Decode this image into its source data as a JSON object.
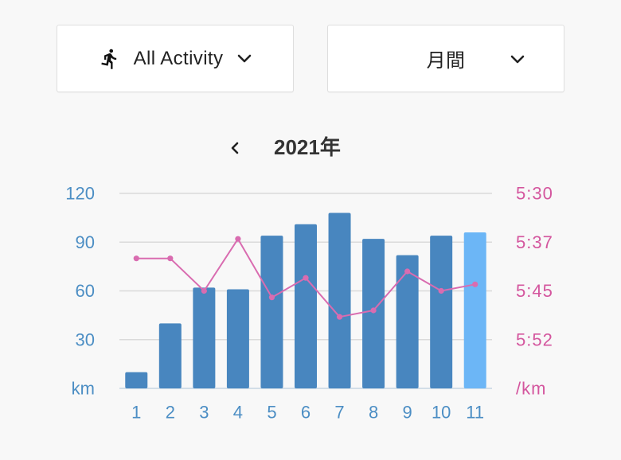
{
  "filters": {
    "activity": {
      "label": "All Activity",
      "icon": "running-person-icon",
      "chevron_icon": "chevron-down-icon"
    },
    "period": {
      "label": "月間",
      "chevron_icon": "chevron-down-icon"
    }
  },
  "year_nav": {
    "prev_icon": "chevron-left-icon",
    "year": "2021年"
  },
  "colors": {
    "background": "#f8f8f8",
    "left_axis": "#4c8ec4",
    "right_axis": "#d4569e",
    "grid": "#dadada",
    "baseline": "#c6d6e3",
    "bar": "#4886bf",
    "bar_current": "#6cb6f6",
    "line": "#d96cb0"
  },
  "chart_data": {
    "type": "bar",
    "categories": [
      "1",
      "2",
      "3",
      "4",
      "5",
      "6",
      "7",
      "8",
      "9",
      "10",
      "11"
    ],
    "series": [
      {
        "type": "bar",
        "axis": "left",
        "values": [
          10,
          40,
          62,
          61,
          94,
          101,
          108,
          92,
          82,
          94,
          96
        ],
        "current_index": 10
      },
      {
        "type": "line",
        "axis": "right",
        "values": [
          "5:40",
          "5:40",
          "5:45",
          "5:37",
          "5:46",
          "5:43",
          "5:49",
          "5:48",
          "5:42",
          "5:45",
          "5:44"
        ]
      }
    ],
    "left_axis": {
      "range": [
        0,
        120
      ],
      "ticks": [
        "120",
        "90",
        "60",
        "30"
      ],
      "unit": "km"
    },
    "right_axis": {
      "range": [
        "5:30",
        "6:00"
      ],
      "inverted": true,
      "ticks": [
        "5:30",
        "5:37",
        "5:45",
        "5:52"
      ],
      "unit": "/km"
    },
    "grid": true
  }
}
